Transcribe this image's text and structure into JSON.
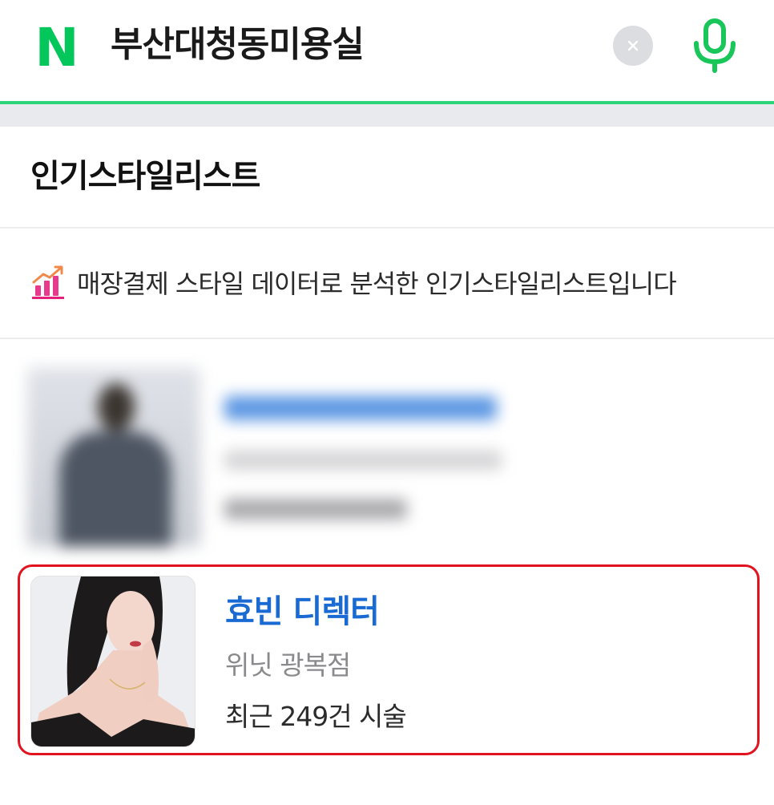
{
  "search": {
    "query": "부산대청동미용실",
    "logo_letter": "N",
    "accent_color": "#2dd57a",
    "clear_icon": "close-icon",
    "mic_icon": "microphone-icon"
  },
  "section": {
    "title": "인기스타일리스트",
    "notice_icon": "bar-chart-trend-icon",
    "notice_text": "매장결제 스타일 데이터로 분석한 인기스타일리스트입니다"
  },
  "stylists": [
    {
      "blurred": true
    },
    {
      "name": "효빈 디렉터",
      "shop": "위닛 광복점",
      "count": "최근 249건 시술",
      "name_color": "#1a6ad3",
      "highlight_color": "#e3121f"
    }
  ]
}
